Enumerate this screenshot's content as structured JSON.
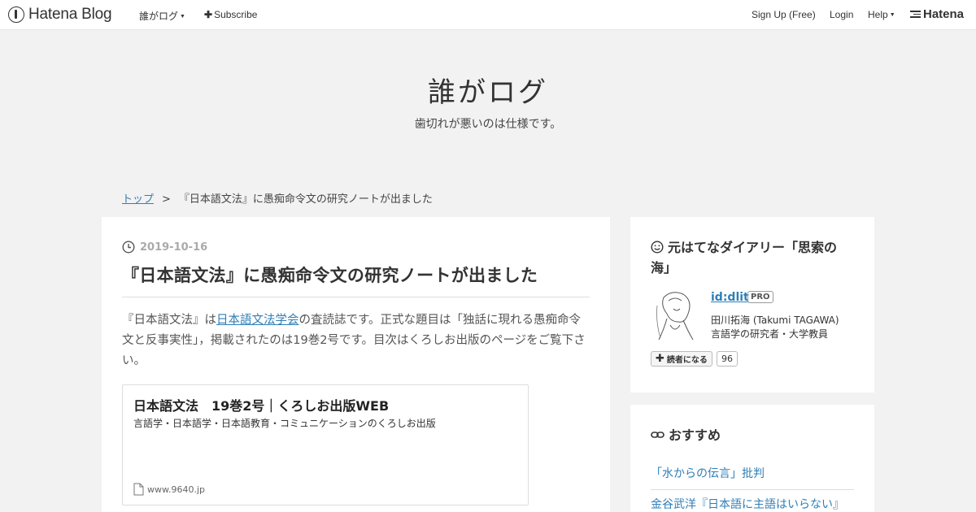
{
  "header": {
    "logo_text": "Hatena Blog",
    "blog_menu_label": "誰がログ",
    "subscribe_label": "Subscribe",
    "signup_label": "Sign Up (Free)",
    "login_label": "Login",
    "help_label": "Help",
    "hatena_label": "Hatena"
  },
  "blog": {
    "title": "誰がログ",
    "description": "歯切れが悪いのは仕様です。"
  },
  "breadcrumb": {
    "top_label": "トップ",
    "separator": ">",
    "current": "『日本語文法』に愚痴命令文の研究ノートが出ました"
  },
  "entry": {
    "date": "2019-10-16",
    "title": "『日本語文法』に愚痴命令文の研究ノートが出ました",
    "body_prefix": "『日本語文法』は",
    "body_link": "日本語文法学会",
    "body_suffix": "の査読誌です。正式な題目は「独話に現れる愚痴命令文と反事実性」，掲載されたのは19巻2号です。目次はくろしお出版のページをご覧下さい。",
    "embed": {
      "title": "日本語文法　19巻2号｜くろしお出版WEB",
      "description": "言語学・日本語学・日本語教育・コミュニケーションのくろしお出版",
      "site": "www.9640.jp"
    }
  },
  "sidebar": {
    "profile_module_title": "元はてなダイアリー「思索の海」",
    "profile_id": "id:dlit",
    "pro_badge": "PRO",
    "profile_name": "田川拓海 (Takumi TAGAWA)",
    "profile_desc": "言語学の研究者・大学教員",
    "subscribe_button": "読者になる",
    "subscriber_count": "96",
    "recommend_module_title": "おすすめ",
    "recommendations": [
      "「水からの伝言」批判",
      "金谷武洋『日本語に主語はいらない』"
    ]
  },
  "colors": {
    "link": "#2f7fb6",
    "background": "#f2f2f2"
  }
}
